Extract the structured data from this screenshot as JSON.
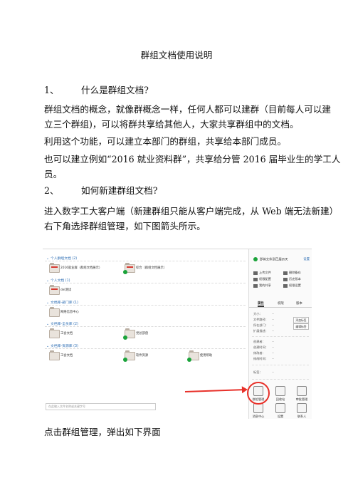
{
  "doc": {
    "title": "群组文档使用说明",
    "q1_num": "1、",
    "q1": "什么是群组文档?",
    "p1_line1": "群组文档的概念，就像群概念一样，任何人都可以建群（目前每人可以建",
    "p1_line2": "立三个群组)，可以将群共享给其他人，大家共享群组中的文档。",
    "p2": "利用这个功能，可以建立本部门的群组，共享给本部门成员。",
    "p3_line1": "也可以建立例如“2016 就业资料群”，共享给分管 2016 届毕业生的学工人",
    "p3_line2": "员。",
    "q2_num": "2、",
    "q2": "如何新建群组文档?",
    "p4_line1": "进入数字工大客户端（新建群组只能从客户端完成，从 Web 端无法新建）",
    "p4_line2": "右下角选择群组管理，如下图箭头所示。",
    "p5": "点击群组管理，弹出如下界面"
  },
  "shot": {
    "sections": [
      "个人群组文档 (2)",
      "个人文档 (1)",
      "文档库-部门库 (1)",
      "文档库-全员库 (2)",
      "文档库-资源库 (3)"
    ],
    "items": [
      "2016就业群（群组文档展示）",
      "综合（群组文档展示）",
      "del测试",
      "网络信息中心",
      "工会文档",
      "党总部盘",
      "工会文档",
      "软件资源",
      "使用帮助"
    ],
    "search_placeholder": "在此输入文件名称或关键字号",
    "right_head": "即将文件到已展示天",
    "right_link": "设置",
    "actions": [
      "上传文件",
      "删除备存",
      "权限配置",
      "历史版本",
      "我的共享",
      "权限设置"
    ],
    "tabs": [
      "属性",
      "权限",
      "版本"
    ],
    "props": [
      {
        "k": "大小：",
        "v": "--"
      },
      {
        "k": "文件路径：",
        "v": "--"
      },
      {
        "k": "所在部门：",
        "v": "--"
      },
      {
        "k": "扩展描述：",
        "v": "--"
      },
      {
        "k": "创建者：",
        "v": "--"
      },
      {
        "k": "创建时间：",
        "v": "--"
      },
      {
        "k": "修改者：",
        "v": "--"
      },
      {
        "k": "修改时间：",
        "v": "--"
      },
      {
        "k": "标签：",
        "v": "--"
      }
    ],
    "prop_buttons": [
      "添加标签",
      "编辑标签"
    ],
    "bottom_icons": [
      "群组管理",
      "回收站",
      "审批管理",
      "消息中心",
      "设置",
      "联系人"
    ]
  }
}
